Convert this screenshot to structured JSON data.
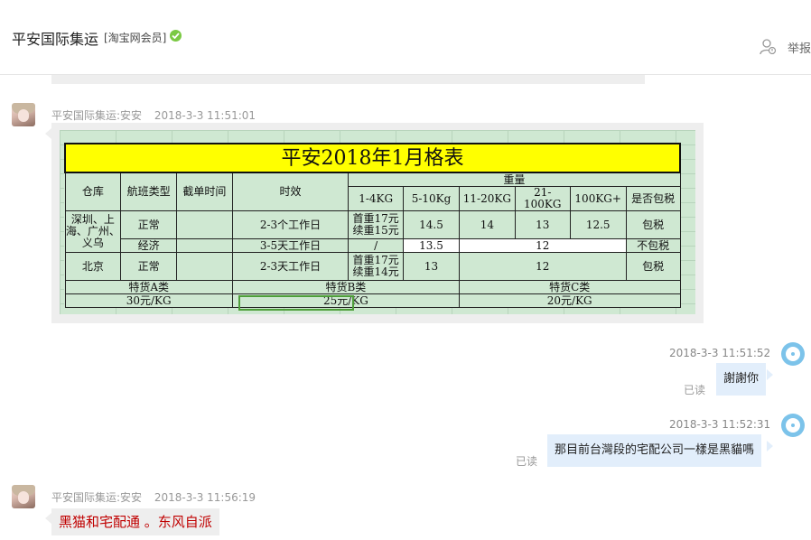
{
  "header": {
    "shop_name": "平安国际集运",
    "badge": "[淘宝网会员]",
    "report_label": "举报"
  },
  "messages": [
    {
      "sender": "平安国际集运:安安",
      "time": "2018-3-3 11:51:01"
    },
    {
      "time": "2018-3-3 11:51:52",
      "text": "謝謝你",
      "status": "已读"
    },
    {
      "time": "2018-3-3 11:52:31",
      "text": "那目前台灣段的宅配公司一樣是黑貓嗎",
      "status": "已读"
    },
    {
      "sender": "平安国际集运:安安",
      "time": "2018-3-3 11:56:19",
      "text": "黑猫和宅配通 。东风自派"
    }
  ],
  "price_table": {
    "title": "平安2018年1月格表",
    "headers": {
      "warehouse": "仓库",
      "flight_type": "航班类型",
      "cutoff": "截单时间",
      "timing": "时效",
      "weight": "重量",
      "tax": "是否包税",
      "ranges": [
        "1-4KG",
        "5-10Kg",
        "11-20KG",
        "21-100KG",
        "100KG+"
      ]
    },
    "rows": [
      {
        "warehouse": "深圳、上海、广州、义乌",
        "flight": "正常",
        "timing": "2-3个工作日",
        "first_weight": "首重17元 续重15元",
        "p5_10": "14.5",
        "p11_20": "14",
        "p21_100": "13",
        "p100": "12.5",
        "tax": "包税"
      },
      {
        "flight": "经济",
        "timing": "3-5天工作日",
        "first_weight": "/",
        "p5_10": "13.5",
        "rest": "12",
        "tax": "不包税"
      },
      {
        "warehouse": "北京",
        "flight": "正常",
        "timing": "2-3天工作日",
        "first_weight": "首重17元 续重14元",
        "p5_10": "13",
        "rest": "12",
        "tax": "包税"
      }
    ],
    "special": [
      {
        "name": "特货A类",
        "price": "30元/KG"
      },
      {
        "name": "特货B类",
        "price": "25元/KG"
      },
      {
        "name": "特货C类",
        "price": "20元/KG"
      }
    ]
  },
  "colors": {
    "title_bg": "#ffff00",
    "sheet_bg": "#cfe8d2",
    "out_bubble": "#e2eefb",
    "in_bubble": "#eeeeee",
    "verified": "#7ac943",
    "reply_text": "#c00000"
  }
}
